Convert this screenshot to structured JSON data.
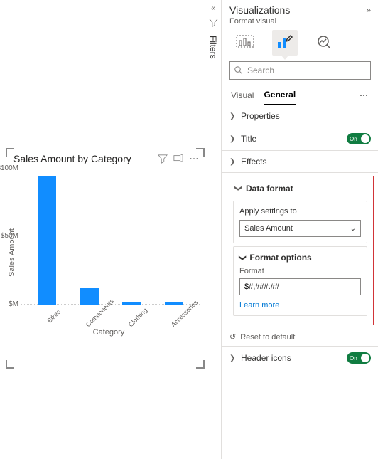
{
  "chart_data": {
    "type": "bar",
    "title": "Sales Amount by Category",
    "xlabel": "Category",
    "ylabel": "Sales Amount",
    "categories": [
      "Bikes",
      "Components",
      "Clothing",
      "Accessories"
    ],
    "values": [
      94000000,
      12000000,
      2000000,
      1500000
    ],
    "y_ticks": [
      "$M",
      "$50M",
      "$100M"
    ],
    "ylim": [
      0,
      100000000
    ]
  },
  "filters_panel": {
    "label": "Filters"
  },
  "viz_panel": {
    "title": "Visualizations",
    "subtitle": "Format visual",
    "search_placeholder": "Search",
    "tabs": {
      "visual": "Visual",
      "general": "General"
    },
    "sections": {
      "properties": "Properties",
      "title": "Title",
      "effects": "Effects",
      "data_format": "Data format",
      "header_icons": "Header icons"
    },
    "toggle_on_label": "On",
    "apply_settings": {
      "label": "Apply settings to",
      "value": "Sales Amount"
    },
    "format_options": {
      "title": "Format options",
      "format_label": "Format",
      "format_value": "$#,###.##",
      "learn_more": "Learn more"
    },
    "reset": "Reset to default"
  }
}
